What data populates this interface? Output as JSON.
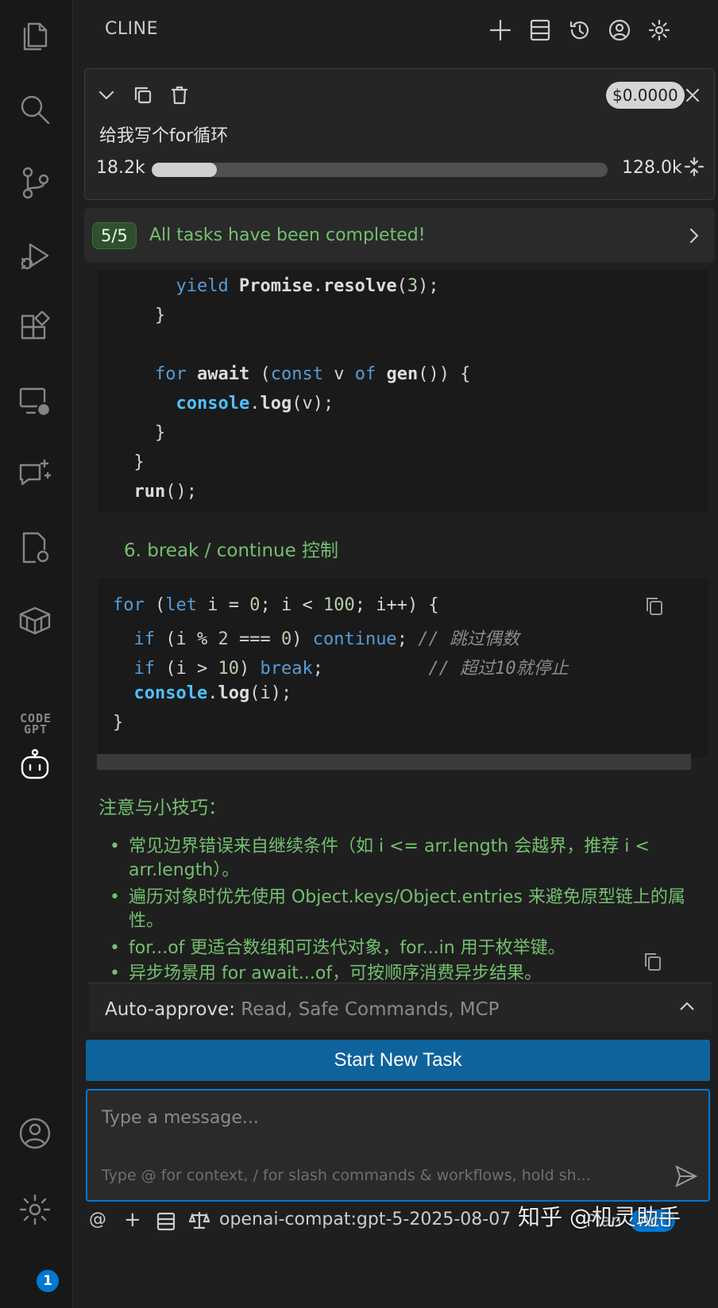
{
  "header": {
    "title": "CLINE"
  },
  "task": {
    "cost": "$0.0000",
    "text": "给我写个for循环",
    "context_used": "18.2k",
    "context_max": "128.0k",
    "context_fraction": 0.142
  },
  "tasks_progress": {
    "count": "5/5",
    "label": "All tasks have been completed!"
  },
  "content": {
    "section6_heading": "6. break / continue 控制",
    "tips_title": "注意与小技巧：",
    "tips": [
      "常见边界错误来自继续条件（如 i <= arr.length 会越界，推荐 i < arr.length）。",
      "遍历对象时优先使用 Object.keys/Object.entries 来避免原型链上的属性。",
      "for...of 更适合数组和可迭代对象，for...in 用于枚举键。",
      "异步场景用 for await...of，可按顺序消费异步结果。"
    ]
  },
  "auto_approve": {
    "label": "Auto-approve:",
    "value": "Read, Safe Commands, MCP"
  },
  "start_button": "Start New Task",
  "input": {
    "placeholder": "Type a message...",
    "hint": "Type @ for context, / for slash commands & workflows, hold sh..."
  },
  "bottom": {
    "at": "@",
    "plus": "+",
    "model": "openai-compat:gpt-5-2025-08-07",
    "mode_plan": "Plan",
    "mode_act": "Act"
  },
  "activity": {
    "codegpt": "CODE GPT",
    "badge": "1"
  },
  "watermark": "知乎 @机灵助手"
}
